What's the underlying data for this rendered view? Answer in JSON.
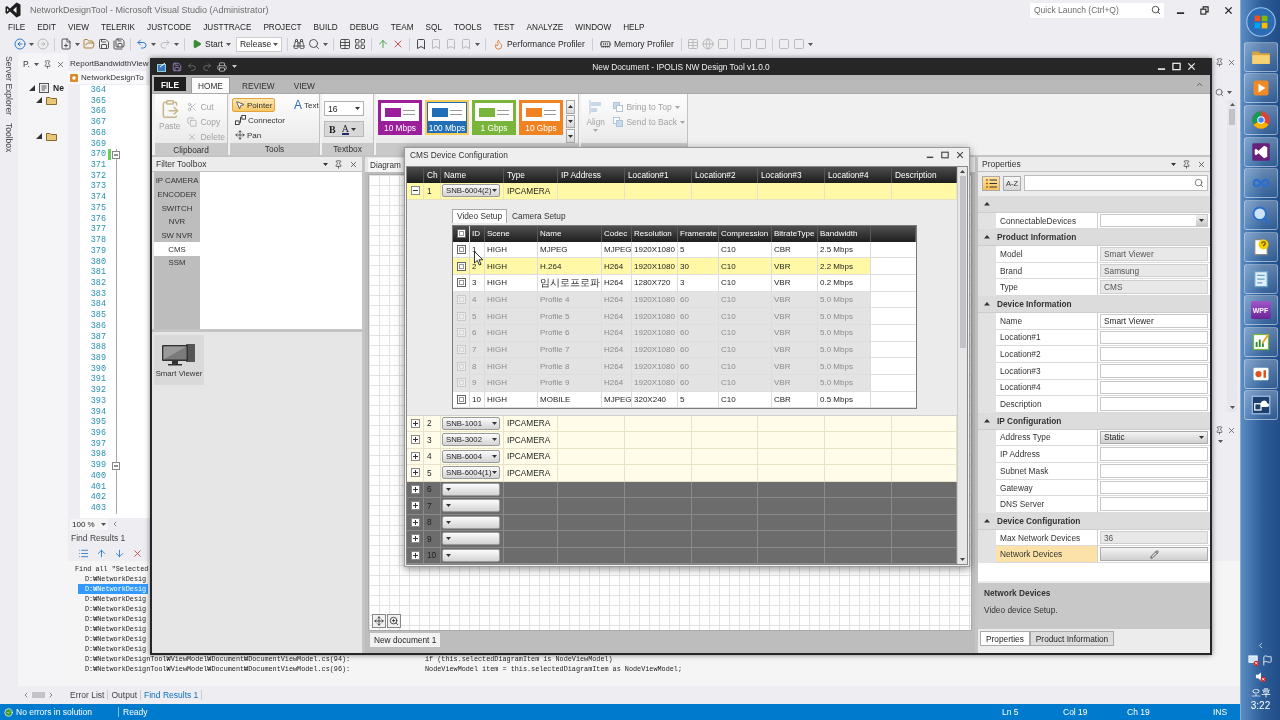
{
  "vs": {
    "title": "NetworkDesignTool - Microsoft Visual Studio (Administrator)",
    "quick_launch": {
      "placeholder": "Quick Launch (Ctrl+Q)"
    },
    "menu": [
      "FILE",
      "EDIT",
      "VIEW",
      "TELERIK",
      "JUSTCODE",
      "JUSTTRACE",
      "PROJECT",
      "BUILD",
      "DEBUG",
      "TEAM",
      "SQL",
      "TOOLS",
      "TEST",
      "ANALYZE",
      "WINDOW",
      "HELP"
    ],
    "toolbar": {
      "start": "Start",
      "configuration": "Release",
      "profilers": [
        "Performance Profiler",
        "Memory Profiler"
      ]
    },
    "side_tabs": [
      "Server Explorer",
      "Toolbox"
    ],
    "solution_explorer": {
      "title": "P.",
      "root": {
        "label": "Ne",
        "expanded": true
      },
      "folders": [
        {
          "expanded": true
        },
        {
          "expanded": true
        }
      ]
    },
    "editor": {
      "tabs": [
        {
          "label": "ReportBandwidthView",
          "selected": false
        },
        {
          "label": "NetworkDesignTo",
          "selected": true
        }
      ],
      "lines": [
        {
          "number": "364",
          "kind": "plain"
        },
        {
          "number": "365",
          "kind": "plain"
        },
        {
          "number": "366",
          "kind": "plain"
        },
        {
          "number": "367",
          "kind": "plain"
        },
        {
          "number": "368",
          "kind": "plain"
        },
        {
          "number": "369",
          "kind": "plain"
        },
        {
          "number": "370",
          "kind": "fold",
          "expanded": true,
          "changed": true
        },
        {
          "number": "371",
          "kind": "plain"
        },
        {
          "number": "372",
          "kind": "plain"
        },
        {
          "number": "373",
          "kind": "plain"
        },
        {
          "number": "374",
          "kind": "plain"
        },
        {
          "number": "375",
          "kind": "plain"
        },
        {
          "number": "376",
          "kind": "plain"
        },
        {
          "number": "377",
          "kind": "plain"
        },
        {
          "number": "378",
          "kind": "plain"
        },
        {
          "number": "379",
          "kind": "plain"
        },
        {
          "number": "380",
          "kind": "plain"
        },
        {
          "number": "381",
          "kind": "plain"
        },
        {
          "number": "382",
          "kind": "plain"
        },
        {
          "number": "383",
          "kind": "plain"
        },
        {
          "number": "384",
          "kind": "plain"
        },
        {
          "number": "385",
          "kind": "plain"
        },
        {
          "number": "386",
          "kind": "plain"
        },
        {
          "number": "387",
          "kind": "plain"
        },
        {
          "number": "388",
          "kind": "plain"
        },
        {
          "number": "389",
          "kind": "plain"
        },
        {
          "number": "390",
          "kind": "plain"
        },
        {
          "number": "391",
          "kind": "plain"
        },
        {
          "number": "392",
          "kind": "plain"
        },
        {
          "number": "393",
          "kind": "plain"
        },
        {
          "number": "394",
          "kind": "plain"
        },
        {
          "number": "395",
          "kind": "plain"
        },
        {
          "number": "396",
          "kind": "plain"
        },
        {
          "number": "397",
          "kind": "plain"
        },
        {
          "number": "398",
          "kind": "plain"
        },
        {
          "number": "399",
          "kind": "fold",
          "expanded": true,
          "changed": false
        },
        {
          "number": "400",
          "kind": "plain"
        },
        {
          "number": "401",
          "kind": "plain"
        },
        {
          "number": "402",
          "kind": "plain"
        },
        {
          "number": "403",
          "kind": "plain"
        }
      ],
      "zoom": "100 %"
    },
    "find_results": {
      "title": "Find Results 1",
      "lines": [
        {
          "text": "Find all \"Selected",
          "kind": "summary",
          "selected": false
        },
        {
          "text": "D:₩NetworkDesig",
          "kind": "result",
          "selected": false
        },
        {
          "text": "D:₩NetworkDesig",
          "kind": "result",
          "selected": true
        },
        {
          "text": "D:₩NetworkDesig",
          "kind": "result",
          "selected": false
        },
        {
          "text": "D:₩NetworkDesig",
          "kind": "result",
          "selected": false
        },
        {
          "text": "D:₩NetworkDesig",
          "kind": "result",
          "selected": false
        },
        {
          "text": "D:₩NetworkDesig",
          "kind": "result",
          "selected": false
        },
        {
          "text": "D:₩NetworkDesig",
          "kind": "result",
          "selected": false
        },
        {
          "text": "D:₩NetworkDesig",
          "kind": "result",
          "selected": false
        }
      ],
      "matches": [
        {
          "path": "D:₩NetworkDesignTool₩ViewModel₩Document₩DocumentViewModel.cs(94):",
          "code": "if (this.selectedDiagramItem is NodeViewModel)"
        },
        {
          "path": "D:₩NetworkDesignTool₩ViewModel₩Document₩DocumentViewModel.cs(96):",
          "code": "NodeViewModel item = this.selectedDiagramItem as NodeViewModel;"
        }
      ]
    },
    "bottom_tabs": [
      {
        "label": "Error List",
        "selected": false
      },
      {
        "label": "Output",
        "selected": false
      },
      {
        "label": "Find Results 1",
        "selected": true
      }
    ],
    "status_bar": {
      "message": "No errors in solution",
      "state": "Ready",
      "fields": [
        "Ln 5",
        "Col 19",
        "Ch 19",
        "INS"
      ]
    }
  },
  "app": {
    "title": "New Document - IPOLIS NW Design Tool v1.0.0",
    "ribbon_tabs": [
      {
        "label": "FILE",
        "kind": "backstage",
        "selected": false
      },
      {
        "label": "HOME",
        "kind": "tab",
        "selected": true
      },
      {
        "label": "REVIEW",
        "kind": "tab",
        "selected": false
      },
      {
        "label": "VIEW",
        "kind": "tab",
        "selected": false
      }
    ],
    "clipboard": {
      "label": "Clipboard",
      "paste": {
        "label": "Paste",
        "disabled": true
      },
      "actions": [
        {
          "label": "Cut",
          "disabled": true
        },
        {
          "label": "Copy",
          "disabled": true
        },
        {
          "label": "Delete",
          "disabled": true
        }
      ]
    },
    "tools": {
      "label": "Tools",
      "items": [
        {
          "label": "Pointer",
          "selected": true
        },
        {
          "label": "Connector",
          "selected": false
        },
        {
          "label": "Pan",
          "selected": false
        },
        {
          "label": "Text",
          "glyph": "A",
          "selected": false
        }
      ]
    },
    "textbox": {
      "label": "Textbox",
      "font_size": "16",
      "bold": "B",
      "font_color": "A"
    },
    "link_styles": [
      {
        "label": "10 Mbps",
        "color": "#9b1f9b",
        "selected": false
      },
      {
        "label": "100 Mbps",
        "color": "#1f6eb6",
        "selected": true
      },
      {
        "label": "1 Gbps",
        "color": "#7ab53b",
        "selected": false
      },
      {
        "label": "10 Gbps",
        "color": "#ef8322",
        "selected": false
      }
    ],
    "arrange": {
      "align": {
        "label": "Align",
        "disabled": true
      },
      "items": [
        {
          "label": "Bring to Top",
          "disabled": true
        },
        {
          "label": "Send to Back",
          "disabled": true
        }
      ]
    },
    "filter_toolbox": {
      "title": "Filter Toolbox",
      "categories": [
        {
          "label": "IP CAMERA",
          "selected": false
        },
        {
          "label": "ENCODER",
          "selected": false
        },
        {
          "label": "SWITCH",
          "selected": false
        },
        {
          "label": "NVR",
          "selected": false
        },
        {
          "label": "SW NVR",
          "selected": false
        },
        {
          "label": "CMS",
          "selected": true
        },
        {
          "label": "SSM",
          "selected": false
        }
      ],
      "devices": [
        {
          "label": "Smart Viewer"
        }
      ]
    },
    "document": {
      "tab": "Diagram",
      "page_tab": "New document 1"
    },
    "cms_dialog": {
      "title": "CMS Device Configuration",
      "columns": [
        "Ch",
        "Name",
        "Type",
        "IP Address",
        "Location#1",
        "Location#2",
        "Location#3",
        "Location#4",
        "Description"
      ],
      "rows": [
        {
          "kind": "device",
          "ch": "1",
          "model": "SNB-6004(2)",
          "type": "IPCAMERA",
          "expanded": true,
          "selected": true,
          "detail": {
            "tabs": [
              {
                "label": "Video Setup",
                "selected": true
              },
              {
                "label": "Camera Setup",
                "selected": false
              }
            ],
            "header_checked": false,
            "columns": [
              "ID",
              "Scene",
              "Name",
              "Codec",
              "Resolution",
              "Framerate",
              "Compression",
              "BitrateType",
              "Bandwidth"
            ],
            "profiles": [
              {
                "id": "1",
                "scene": "HIGH",
                "name": "MJPEG",
                "codec": "MJPEG",
                "resolution": "1920X1080",
                "framerate": "5",
                "compression": "C10",
                "bitrate_type": "CBR",
                "bandwidth": "2.5 Mbps",
                "checked": false,
                "disabled": false,
                "selected": false
              },
              {
                "id": "2",
                "scene": "HIGH",
                "name": "H.264",
                "codec": "H264",
                "resolution": "1920X1080",
                "framerate": "30",
                "compression": "C10",
                "bitrate_type": "VBR",
                "bandwidth": "2.2 Mbps",
                "checked": false,
                "disabled": false,
                "selected": true
              },
              {
                "id": "3",
                "scene": "HIGH",
                "name": "임시로프로파",
                "codec": "H264",
                "resolution": "1280X720",
                "framerate": "3",
                "compression": "C10",
                "bitrate_type": "VBR",
                "bandwidth": "0.2 Mbps",
                "checked": false,
                "disabled": false,
                "selected": false
              },
              {
                "id": "4",
                "scene": "HIGH",
                "name": "Profile 4",
                "codec": "H264",
                "resolution": "1920X1080",
                "framerate": "60",
                "compression": "C10",
                "bitrate_type": "VBR",
                "bandwidth": "5.0 Mbps",
                "checked": false,
                "disabled": true,
                "selected": false
              },
              {
                "id": "5",
                "scene": "HIGH",
                "name": "Profile 5",
                "codec": "H264",
                "resolution": "1920X1080",
                "framerate": "60",
                "compression": "C10",
                "bitrate_type": "VBR",
                "bandwidth": "5.0 Mbps",
                "checked": false,
                "disabled": true,
                "selected": false
              },
              {
                "id": "6",
                "scene": "HIGH",
                "name": "Profile 6",
                "codec": "H264",
                "resolution": "1920X1080",
                "framerate": "60",
                "compression": "C10",
                "bitrate_type": "VBR",
                "bandwidth": "5.0 Mbps",
                "checked": false,
                "disabled": true,
                "selected": false
              },
              {
                "id": "7",
                "scene": "HIGH",
                "name": "Profile 7",
                "codec": "H264",
                "resolution": "1920X1080",
                "framerate": "60",
                "compression": "C10",
                "bitrate_type": "VBR",
                "bandwidth": "5.0 Mbps",
                "checked": false,
                "disabled": true,
                "selected": false
              },
              {
                "id": "8",
                "scene": "HIGH",
                "name": "Profile 8",
                "codec": "H264",
                "resolution": "1920X1080",
                "framerate": "60",
                "compression": "C10",
                "bitrate_type": "VBR",
                "bandwidth": "5.0 Mbps",
                "checked": false,
                "disabled": true,
                "selected": false
              },
              {
                "id": "9",
                "scene": "HIGH",
                "name": "Profile 9",
                "codec": "H264",
                "resolution": "1920X1080",
                "framerate": "60",
                "compression": "C10",
                "bitrate_type": "VBR",
                "bandwidth": "5.0 Mbps",
                "checked": false,
                "disabled": true,
                "selected": false
              },
              {
                "id": "10",
                "scene": "HIGH",
                "name": "MOBILE",
                "codec": "MJPEG",
                "resolution": "320X240",
                "framerate": "5",
                "compression": "C10",
                "bitrate_type": "CBR",
                "bandwidth": "0.5 Mbps",
                "checked": false,
                "disabled": false,
                "selected": false
              }
            ]
          }
        },
        {
          "kind": "device",
          "ch": "2",
          "model": "SNB-1001",
          "type": "IPCAMERA",
          "expanded": false,
          "selected": false
        },
        {
          "kind": "device",
          "ch": "3",
          "model": "SNB-3002",
          "type": "IPCAMERA",
          "expanded": false,
          "selected": false
        },
        {
          "kind": "device",
          "ch": "4",
          "model": "SNB-6004",
          "type": "IPCAMERA",
          "expanded": false,
          "selected": false
        },
        {
          "kind": "device",
          "ch": "5",
          "model": "SNB-6004(1)",
          "type": "IPCAMERA",
          "expanded": false,
          "selected": false
        },
        {
          "kind": "empty",
          "ch": "6",
          "expanded": false,
          "selected": false
        },
        {
          "kind": "empty",
          "ch": "7",
          "expanded": false,
          "selected": false
        },
        {
          "kind": "empty",
          "ch": "8",
          "expanded": false,
          "selected": false
        },
        {
          "kind": "empty",
          "ch": "9",
          "expanded": false,
          "selected": false
        },
        {
          "kind": "empty",
          "ch": "10",
          "expanded": false,
          "selected": false
        }
      ]
    },
    "properties": {
      "title": "Properties",
      "view_modes": [
        {
          "kind": "categorized",
          "selected": true
        },
        {
          "kind": "alphabetical",
          "label": "A-Z",
          "selected": false
        }
      ],
      "groups": [
        {
          "expanded": true,
          "rows": [
            {
              "name": "ConnectableDevices",
              "kind": "dropdown",
              "selected": false
            }
          ]
        },
        {
          "title": "Product Information",
          "expanded": true,
          "rows": [
            {
              "name": "Model",
              "value": "Smart Viewer",
              "kind": "readonly",
              "selected": false
            },
            {
              "name": "Brand",
              "value": "Samsung",
              "kind": "readonly",
              "selected": false
            },
            {
              "name": "Type",
              "value": "CMS",
              "kind": "readonly",
              "selected": false
            }
          ]
        },
        {
          "title": "Device Information",
          "expanded": true,
          "rows": [
            {
              "name": "Name",
              "value": "Smart Viewer",
              "kind": "text",
              "selected": false
            },
            {
              "name": "Location#1",
              "kind": "text",
              "selected": false
            },
            {
              "name": "Location#2",
              "kind": "text",
              "selected": false
            },
            {
              "name": "Location#3",
              "kind": "text",
              "selected": false
            },
            {
              "name": "Location#4",
              "kind": "text",
              "selected": false
            },
            {
              "name": "Description",
              "kind": "text",
              "selected": false
            }
          ]
        },
        {
          "title": "IP Configuration",
          "expanded": true,
          "rows": [
            {
              "name": "Address Type",
              "value": "Static",
              "kind": "combo",
              "selected": false
            },
            {
              "name": "IP Address",
              "kind": "text",
              "selected": false
            },
            {
              "name": "Subnet Mask",
              "kind": "text",
              "selected": false
            },
            {
              "name": "Gateway",
              "kind": "text",
              "selected": false
            },
            {
              "name": "DNS Server",
              "kind": "text",
              "selected": false
            }
          ]
        },
        {
          "title": "Device Configuration",
          "expanded": true,
          "rows": [
            {
              "name": "Max Network Devices",
              "value": "36",
              "kind": "readonly",
              "selected": false
            },
            {
              "name": "Network Devices",
              "kind": "editor",
              "selected": true
            }
          ]
        }
      ],
      "description": {
        "title": "Network Devices",
        "text": "Video device Setup."
      },
      "tabs": [
        {
          "label": "Properties",
          "selected": true
        },
        {
          "label": "Product Information",
          "selected": false
        }
      ]
    }
  },
  "taskbar": {
    "tile_text": "WPF",
    "clock": "오후 3:22"
  }
}
